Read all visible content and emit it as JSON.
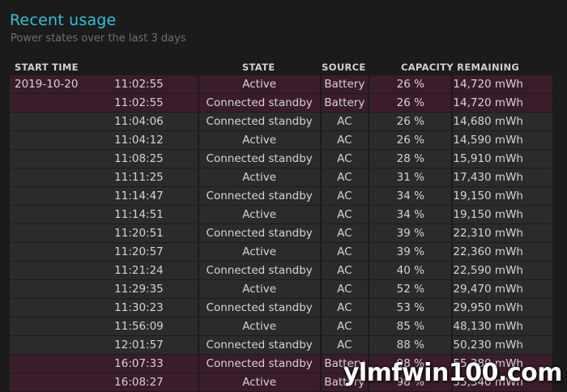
{
  "header": {
    "title": "Recent usage",
    "subtitle": "Power states over the last 3 days"
  },
  "columns": {
    "start_time": "START TIME",
    "state": "STATE",
    "source": "SOURCE",
    "capacity": "CAPACITY REMAINING"
  },
  "rows": [
    {
      "date": "2019-10-20",
      "time": "11:02:55",
      "state": "Active",
      "source": "Battery",
      "percent": "26 %",
      "energy": "14,720 mWh"
    },
    {
      "date": "",
      "time": "11:02:55",
      "state": "Connected standby",
      "source": "Battery",
      "percent": "26 %",
      "energy": "14,720 mWh"
    },
    {
      "date": "",
      "time": "11:04:06",
      "state": "Connected standby",
      "source": "AC",
      "percent": "26 %",
      "energy": "14,680 mWh"
    },
    {
      "date": "",
      "time": "11:04:12",
      "state": "Active",
      "source": "AC",
      "percent": "26 %",
      "energy": "14,590 mWh"
    },
    {
      "date": "",
      "time": "11:08:25",
      "state": "Connected standby",
      "source": "AC",
      "percent": "28 %",
      "energy": "15,910 mWh"
    },
    {
      "date": "",
      "time": "11:11:25",
      "state": "Active",
      "source": "AC",
      "percent": "31 %",
      "energy": "17,430 mWh"
    },
    {
      "date": "",
      "time": "11:14:47",
      "state": "Connected standby",
      "source": "AC",
      "percent": "34 %",
      "energy": "19,150 mWh"
    },
    {
      "date": "",
      "time": "11:14:51",
      "state": "Active",
      "source": "AC",
      "percent": "34 %",
      "energy": "19,150 mWh"
    },
    {
      "date": "",
      "time": "11:20:51",
      "state": "Connected standby",
      "source": "AC",
      "percent": "39 %",
      "energy": "22,310 mWh"
    },
    {
      "date": "",
      "time": "11:20:57",
      "state": "Active",
      "source": "AC",
      "percent": "39 %",
      "energy": "22,360 mWh"
    },
    {
      "date": "",
      "time": "11:21:24",
      "state": "Connected standby",
      "source": "AC",
      "percent": "40 %",
      "energy": "22,590 mWh"
    },
    {
      "date": "",
      "time": "11:29:35",
      "state": "Active",
      "source": "AC",
      "percent": "52 %",
      "energy": "29,470 mWh"
    },
    {
      "date": "",
      "time": "11:30:23",
      "state": "Connected standby",
      "source": "AC",
      "percent": "53 %",
      "energy": "29,950 mWh"
    },
    {
      "date": "",
      "time": "11:56:09",
      "state": "Active",
      "source": "AC",
      "percent": "85 %",
      "energy": "48,130 mWh"
    },
    {
      "date": "",
      "time": "12:01:57",
      "state": "Connected standby",
      "source": "AC",
      "percent": "88 %",
      "energy": "50,230 mWh"
    },
    {
      "date": "",
      "time": "16:07:33",
      "state": "Connected standby",
      "source": "Battery",
      "percent": "98 %",
      "energy": "55,380 mWh"
    },
    {
      "date": "",
      "time": "16:08:27",
      "state": "Active",
      "source": "Battery",
      "percent": "98 %",
      "energy": "55,340 mWh"
    }
  ],
  "colors": {
    "title": "#2ec4d6",
    "row_ac": "#2b2b2b",
    "row_battery": "#3b1c2b"
  },
  "watermark": "ylmfwin100.com"
}
